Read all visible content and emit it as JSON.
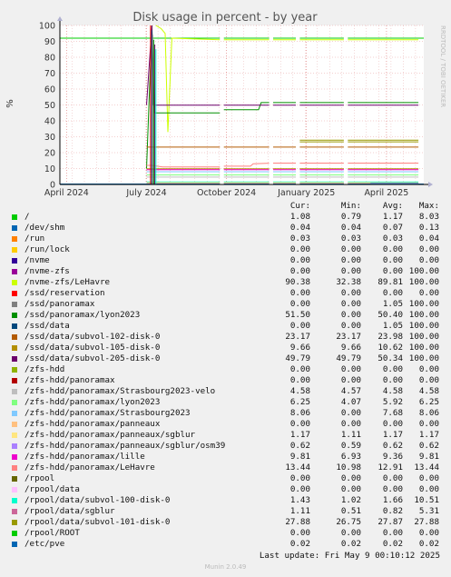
{
  "chart_data": {
    "type": "line",
    "title": "Disk usage in percent - by year",
    "ylabel": "%",
    "ylim": [
      0,
      100
    ],
    "yticks": [
      0,
      10,
      20,
      30,
      40,
      50,
      60,
      70,
      80,
      90,
      100
    ],
    "xticks": [
      "April 2024",
      "July 2024",
      "October 2024",
      "January 2025",
      "April 2025"
    ],
    "grid": true,
    "side_text": "RRDTOOL / TOBI OETIKER",
    "series": [
      {
        "name": "/",
        "color": "#00cc00",
        "cur": "1.08",
        "min": "0.79",
        "avg": "1.17",
        "max": "8.03"
      },
      {
        "name": "/dev/shm",
        "color": "#0066b3",
        "cur": "0.04",
        "min": "0.04",
        "avg": "0.07",
        "max": "0.13"
      },
      {
        "name": "/run",
        "color": "#ff8000",
        "cur": "0.03",
        "min": "0.03",
        "avg": "0.03",
        "max": "0.04"
      },
      {
        "name": "/run/lock",
        "color": "#ffcc00",
        "cur": "0.00",
        "min": "0.00",
        "avg": "0.00",
        "max": "0.00"
      },
      {
        "name": "/nvme",
        "color": "#330099",
        "cur": "0.00",
        "min": "0.00",
        "avg": "0.00",
        "max": "0.00"
      },
      {
        "name": "/nvme-zfs",
        "color": "#990099",
        "cur": "0.00",
        "min": "0.00",
        "avg": "0.00",
        "max": "100.00"
      },
      {
        "name": "/nvme-zfs/LeHavre",
        "color": "#ccff00",
        "cur": "90.38",
        "min": "32.38",
        "avg": "89.81",
        "max": "100.00"
      },
      {
        "name": "/ssd/reservation",
        "color": "#ff0000",
        "cur": "0.00",
        "min": "0.00",
        "avg": "0.00",
        "max": "0.00"
      },
      {
        "name": "/ssd/panoramax",
        "color": "#808080",
        "cur": "0.00",
        "min": "0.00",
        "avg": "1.05",
        "max": "100.00"
      },
      {
        "name": "/ssd/panoramax/lyon2023",
        "color": "#008f00",
        "cur": "51.50",
        "min": "0.00",
        "avg": "50.40",
        "max": "100.00"
      },
      {
        "name": "/ssd/data",
        "color": "#00487d",
        "cur": "0.00",
        "min": "0.00",
        "avg": "1.05",
        "max": "100.00"
      },
      {
        "name": "/ssd/data/subvol-102-disk-0",
        "color": "#b35a00",
        "cur": "23.17",
        "min": "23.17",
        "avg": "23.98",
        "max": "100.00"
      },
      {
        "name": "/ssd/data/subvol-105-disk-0",
        "color": "#b38f00",
        "cur": "9.66",
        "min": "9.66",
        "avg": "10.62",
        "max": "100.00"
      },
      {
        "name": "/ssd/data/subvol-205-disk-0",
        "color": "#6b006b",
        "cur": "49.79",
        "min": "49.79",
        "avg": "50.34",
        "max": "100.00"
      },
      {
        "name": "/zfs-hdd",
        "color": "#8fb300",
        "cur": "0.00",
        "min": "0.00",
        "avg": "0.00",
        "max": "0.00"
      },
      {
        "name": "/zfs-hdd/panoramax",
        "color": "#b30000",
        "cur": "0.00",
        "min": "0.00",
        "avg": "0.00",
        "max": "0.00"
      },
      {
        "name": "/zfs-hdd/panoramax/Strasbourg2023-velo",
        "color": "#bebebe",
        "cur": "4.58",
        "min": "4.57",
        "avg": "4.58",
        "max": "4.58"
      },
      {
        "name": "/zfs-hdd/panoramax/lyon2023",
        "color": "#80ff80",
        "cur": "6.25",
        "min": "4.07",
        "avg": "5.92",
        "max": "6.25"
      },
      {
        "name": "/zfs-hdd/panoramax/Strasbourg2023",
        "color": "#80c9ff",
        "cur": "8.06",
        "min": "0.00",
        "avg": "7.68",
        "max": "8.06"
      },
      {
        "name": "/zfs-hdd/panoramax/panneaux",
        "color": "#ffc080",
        "cur": "0.00",
        "min": "0.00",
        "avg": "0.00",
        "max": "0.00"
      },
      {
        "name": "/zfs-hdd/panoramax/panneaux/sgblur",
        "color": "#ffe680",
        "cur": "1.17",
        "min": "1.11",
        "avg": "1.17",
        "max": "1.17"
      },
      {
        "name": "/zfs-hdd/panoramax/panneaux/sgblur/osm39",
        "color": "#aa80ff",
        "cur": "0.62",
        "min": "0.59",
        "avg": "0.62",
        "max": "0.62"
      },
      {
        "name": "/zfs-hdd/panoramax/lille",
        "color": "#ee00cc",
        "cur": "9.81",
        "min": "6.93",
        "avg": "9.36",
        "max": "9.81"
      },
      {
        "name": "/zfs-hdd/panoramax/LeHavre",
        "color": "#ff8080",
        "cur": "13.44",
        "min": "10.98",
        "avg": "12.91",
        "max": "13.44"
      },
      {
        "name": "/rpool",
        "color": "#666600",
        "cur": "0.00",
        "min": "0.00",
        "avg": "0.00",
        "max": "0.00"
      },
      {
        "name": "/rpool/data",
        "color": "#ffbfff",
        "cur": "0.00",
        "min": "0.00",
        "avg": "0.00",
        "max": "0.00"
      },
      {
        "name": "/rpool/data/subvol-100-disk-0",
        "color": "#00ffcc",
        "cur": "1.43",
        "min": "1.02",
        "avg": "1.66",
        "max": "10.51"
      },
      {
        "name": "/rpool/data/sgblur",
        "color": "#cc6699",
        "cur": "1.11",
        "min": "0.51",
        "avg": "0.82",
        "max": "5.31"
      },
      {
        "name": "/rpool/data/subvol-101-disk-0",
        "color": "#999900",
        "cur": "27.88",
        "min": "26.75",
        "avg": "27.87",
        "max": "27.88"
      },
      {
        "name": "/rpool/ROOT",
        "color": "#00cc00",
        "cur": "0.00",
        "min": "0.00",
        "avg": "0.00",
        "max": "0.00"
      },
      {
        "name": "/etc/pve",
        "color": "#0066b3",
        "cur": "0.02",
        "min": "0.02",
        "avg": "0.02",
        "max": "0.02"
      }
    ],
    "legend_headers": {
      "cur": "Cur:",
      "min": "Min:",
      "avg": "Avg:",
      "max": "Max:"
    }
  },
  "footer": {
    "last_update": "Last update: Fri May  9 00:10:12 2025",
    "generator": "Munin 2.0.49"
  }
}
